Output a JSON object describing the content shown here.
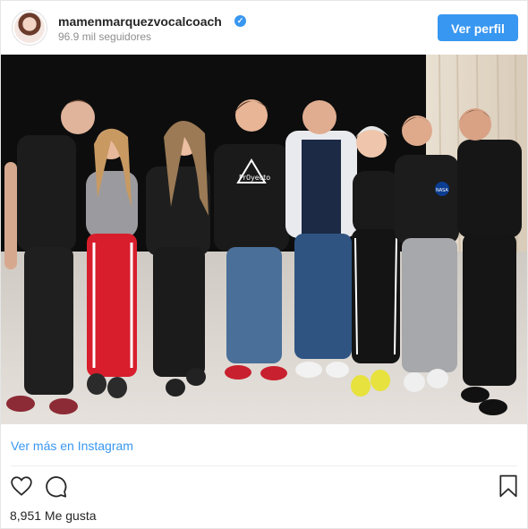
{
  "header": {
    "username": "mamenmarquezvocalcoach",
    "followers": "96.9 mil seguidores",
    "profile_button": "Ver perfil"
  },
  "post": {
    "view_more": "Ver más en Instagram",
    "likes": "8,951 Me gusta",
    "shirt_text": "Pr0yecto",
    "nasa_badge": "NASA"
  },
  "icons": {
    "like": "heart-icon",
    "comment": "comment-icon",
    "save": "bookmark-icon",
    "verified": "verified-badge-icon"
  },
  "colors": {
    "accent": "#3897f0",
    "text": "#262626",
    "muted": "#8e8e8e"
  }
}
